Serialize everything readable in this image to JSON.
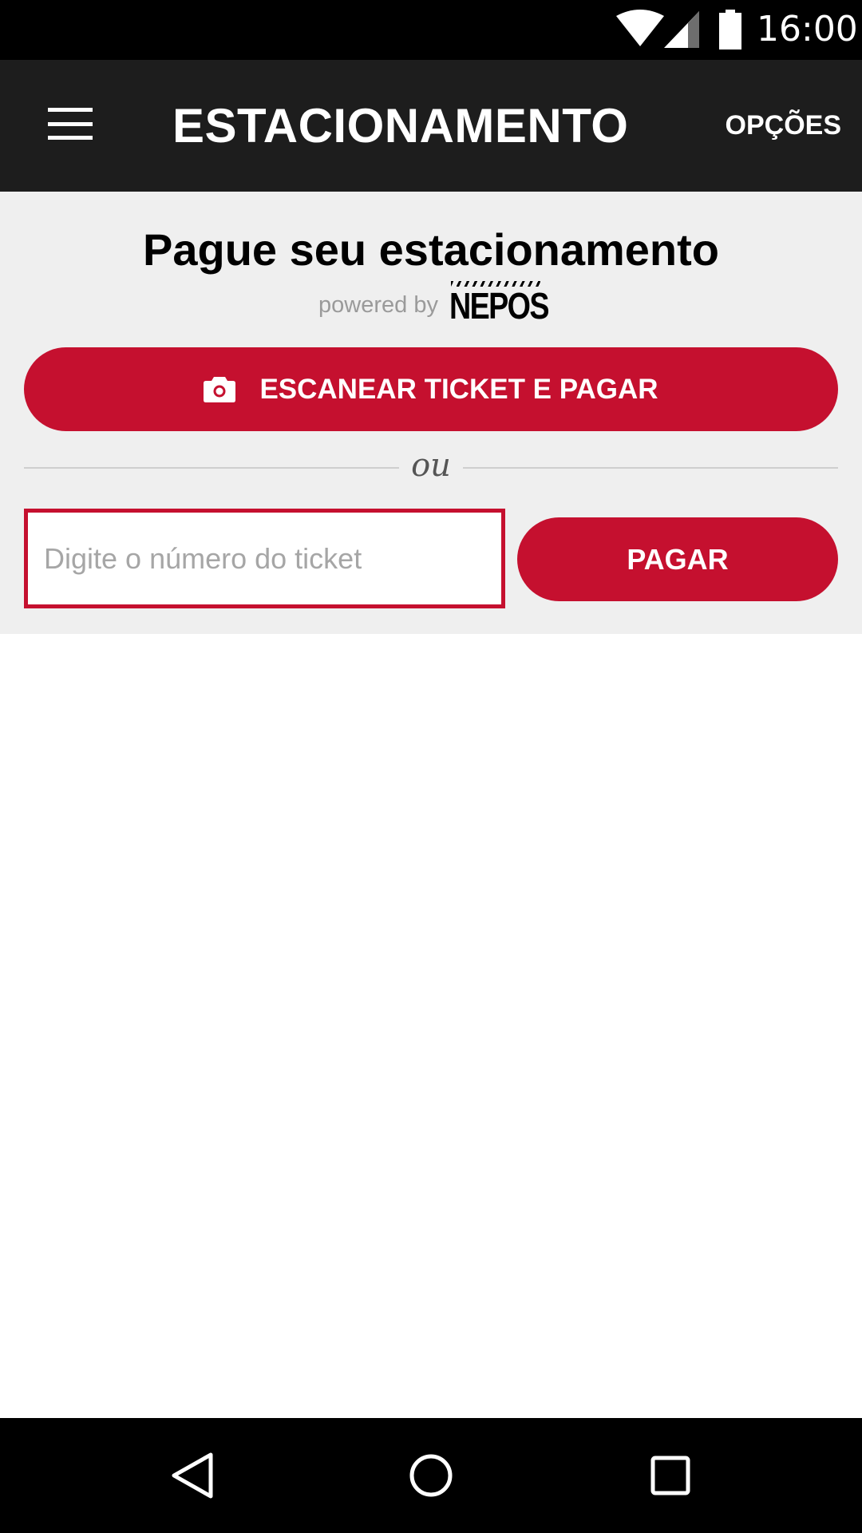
{
  "status_bar": {
    "time": "16:00",
    "icons": [
      "wifi-icon",
      "cell-signal-icon",
      "battery-icon"
    ]
  },
  "app_bar": {
    "menu_icon": "hamburger-menu-icon",
    "title": "ESTACIONAMENTO",
    "options_label": "OPÇÕES"
  },
  "panel": {
    "title": "Pague seu estacionamento",
    "powered_by": "powered by",
    "brand": "NEPOS",
    "scan_button": {
      "icon": "camera-icon",
      "label": "ESCANEAR TICKET E PAGAR"
    },
    "or_text": "ou",
    "ticket_input": {
      "placeholder": "Digite o número do ticket",
      "value": ""
    },
    "pay_button_label": "PAGAR"
  },
  "nav_bar": {
    "items": [
      "back-icon",
      "home-icon",
      "recents-icon"
    ]
  },
  "colors": {
    "accent": "#c5102f",
    "app_bar": "#1d1d1d",
    "panel_bg": "#efefef"
  }
}
